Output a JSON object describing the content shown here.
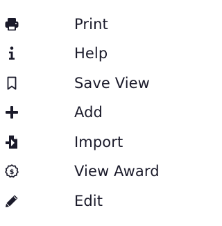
{
  "menu": {
    "items": [
      {
        "label": "Print",
        "icon": "print-icon"
      },
      {
        "label": "Help",
        "icon": "info-icon"
      },
      {
        "label": "Save View",
        "icon": "bookmark-icon"
      },
      {
        "label": "Add",
        "icon": "plus-icon"
      },
      {
        "label": "Import",
        "icon": "import-icon"
      },
      {
        "label": "View Award",
        "icon": "award-icon"
      },
      {
        "label": "Edit",
        "icon": "pencil-icon"
      }
    ]
  },
  "colors": {
    "text": "#1a1a2a",
    "icon": "#1a1a2a"
  }
}
